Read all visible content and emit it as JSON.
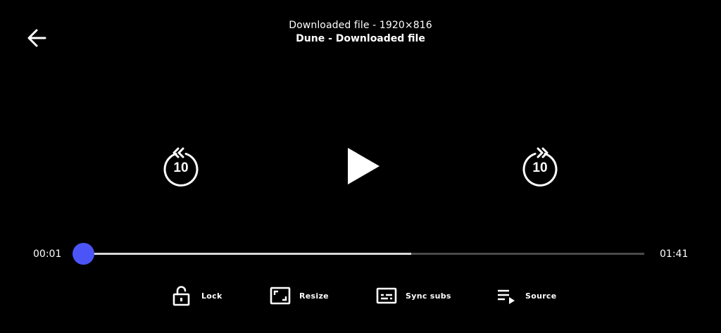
{
  "header": {
    "back_icon": "arrow-left-icon",
    "subtitle": "Downloaded file - 1920×816",
    "title": "Dune - Downloaded file"
  },
  "controls": {
    "rewind": {
      "icon": "replay-10-icon",
      "label": "10"
    },
    "play": {
      "icon": "play-icon"
    },
    "forward": {
      "icon": "forward-10-icon",
      "label": "10"
    }
  },
  "seekbar": {
    "current_time": "00:01",
    "total_time": "01:41",
    "progress_fraction": 0.0,
    "buffered_fraction": 0.585
  },
  "actions": [
    {
      "label": "Lock",
      "icon": "lock-open-icon"
    },
    {
      "label": "Resize",
      "icon": "resize-icon"
    },
    {
      "label": "Sync subs",
      "icon": "subtitles-icon"
    },
    {
      "label": "Source",
      "icon": "playlist-icon"
    }
  ],
  "colors": {
    "background": "#000000",
    "accent": "#4b55f7",
    "text": "#ffffff"
  }
}
